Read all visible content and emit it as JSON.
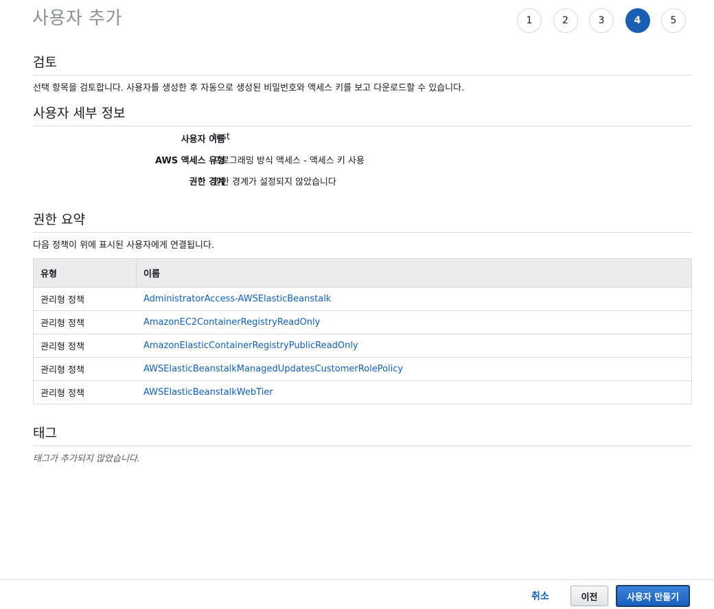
{
  "header": {
    "title": "사용자 추가"
  },
  "steps": [
    "1",
    "2",
    "3",
    "4",
    "5"
  ],
  "active_step": "4",
  "review": {
    "title": "검토",
    "description": "선택 항목을 검토합니다. 사용자를 생성한 후 자동으로 생성된 비밀번호와 액세스 키를 보고 다운로드할 수 있습니다."
  },
  "user_details": {
    "title": "사용자 세부 정보",
    "rows": [
      {
        "label": "사용자 이름",
        "value": "test"
      },
      {
        "label": "AWS 액세스 유형",
        "value": "프로그래밍 방식 액세스 - 액세스 키 사용"
      },
      {
        "label": "권한 경계",
        "value": "권한 경계가 설정되지 않았습니다"
      }
    ]
  },
  "permissions": {
    "title": "권한 요약",
    "description": "다음 정책이 위에 표시된 사용자에게 연결됩니다.",
    "columns": [
      "유형",
      "이름"
    ],
    "rows": [
      {
        "type": "관리형 정책",
        "name": "AdministratorAccess-AWSElasticBeanstalk"
      },
      {
        "type": "관리형 정책",
        "name": "AmazonEC2ContainerRegistryReadOnly"
      },
      {
        "type": "관리형 정책",
        "name": "AmazonElasticContainerRegistryPublicReadOnly"
      },
      {
        "type": "관리형 정책",
        "name": "AWSElasticBeanstalkManagedUpdatesCustomerRolePolicy"
      },
      {
        "type": "관리형 정책",
        "name": "AWSElasticBeanstalkWebTier"
      }
    ]
  },
  "tags": {
    "title": "태그",
    "empty_text": "태그가 추가되지 않았습니다."
  },
  "footer": {
    "cancel_label": "취소",
    "previous_label": "이전",
    "create_label": "사용자 만들기"
  },
  "colors": {
    "accent": "#1a5fb4",
    "link": "#0f5fbd",
    "title_gray": "#879196",
    "border": "#d5dbdb"
  }
}
